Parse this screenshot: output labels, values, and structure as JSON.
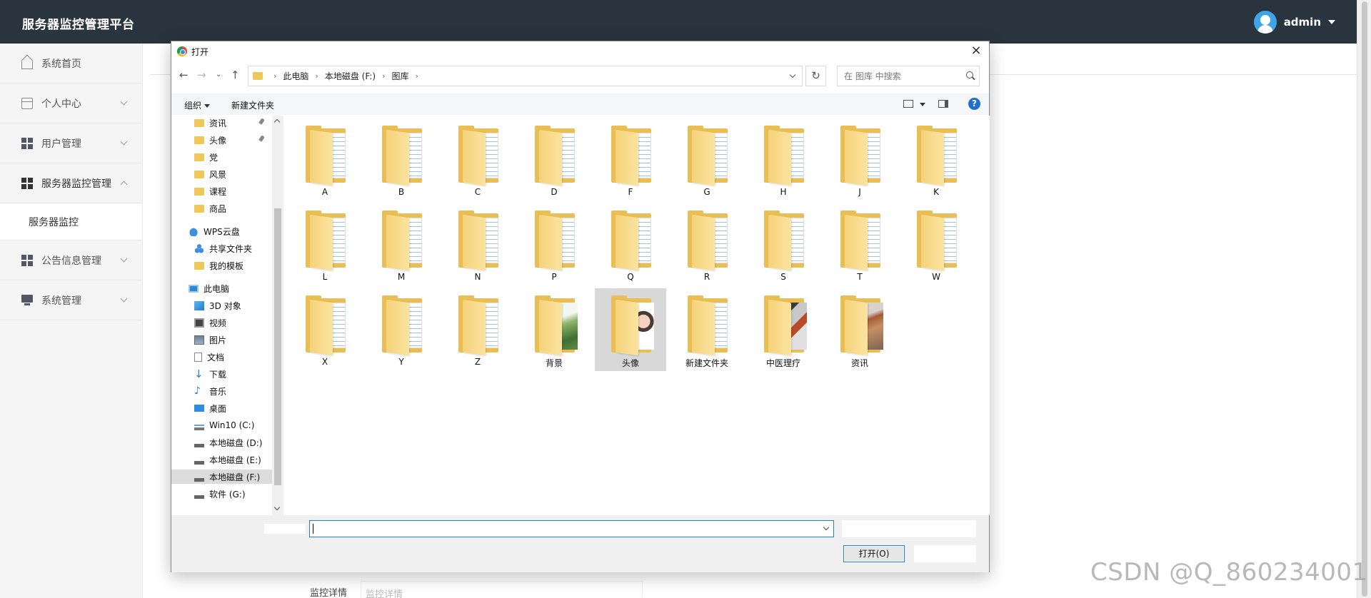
{
  "header": {
    "title": "服务器监控管理平台",
    "username": "admin"
  },
  "sidebar": {
    "items": [
      {
        "label": "系统首页"
      },
      {
        "label": "个人中心"
      },
      {
        "label": "用户管理"
      },
      {
        "label": "服务器监控管理"
      },
      {
        "label": "服务器监控"
      },
      {
        "label": "公告信息管理"
      },
      {
        "label": "系统管理"
      }
    ]
  },
  "background": {
    "tab1": "监控详情",
    "tab2": "监控详情"
  },
  "dialog": {
    "title": "打开",
    "close": "×",
    "breadcrumb": [
      "此电脑",
      "本地磁盘 (F:)",
      "图库"
    ],
    "search_placeholder": "在 图库 中搜索",
    "toolbar": {
      "organize": "组织",
      "new_folder": "新建文件夹",
      "help": "?"
    },
    "tree": [
      {
        "label": "资讯"
      },
      {
        "label": "头像"
      },
      {
        "label": "党"
      },
      {
        "label": "风景"
      },
      {
        "label": "课程"
      },
      {
        "label": "商品"
      },
      {
        "label": "WPS云盘"
      },
      {
        "label": "共享文件夹"
      },
      {
        "label": "我的模板"
      },
      {
        "label": "此电脑"
      },
      {
        "label": "3D 对象"
      },
      {
        "label": "视频"
      },
      {
        "label": "图片"
      },
      {
        "label": "文档"
      },
      {
        "label": "下载"
      },
      {
        "label": "音乐"
      },
      {
        "label": "桌面"
      },
      {
        "label": "Win10 (C:)"
      },
      {
        "label": "本地磁盘 (D:)"
      },
      {
        "label": "本地磁盘 (E:)"
      },
      {
        "label": "本地磁盘 (F:)"
      },
      {
        "label": "软件 (G:)"
      }
    ],
    "files": [
      {
        "name": "A"
      },
      {
        "name": "B"
      },
      {
        "name": "C"
      },
      {
        "name": "D"
      },
      {
        "name": "F"
      },
      {
        "name": "G"
      },
      {
        "name": "H"
      },
      {
        "name": "J"
      },
      {
        "name": "K"
      },
      {
        "name": "L"
      },
      {
        "name": "M"
      },
      {
        "name": "N"
      },
      {
        "name": "P"
      },
      {
        "name": "Q"
      },
      {
        "name": "R"
      },
      {
        "name": "S"
      },
      {
        "name": "T"
      },
      {
        "name": "W"
      },
      {
        "name": "X"
      },
      {
        "name": "Y"
      },
      {
        "name": "Z"
      },
      {
        "name": "背景"
      },
      {
        "name": "头像"
      },
      {
        "name": "新建文件夹"
      },
      {
        "name": "中医理疗"
      },
      {
        "name": "资讯"
      }
    ],
    "filename_value": "",
    "open_button": "打开(O)"
  },
  "watermark": "CSDN @Q_860234001",
  "colors": {
    "header_bg": "#2a343e",
    "accent": "#2b7bd3",
    "folder": "#f0c85a"
  }
}
